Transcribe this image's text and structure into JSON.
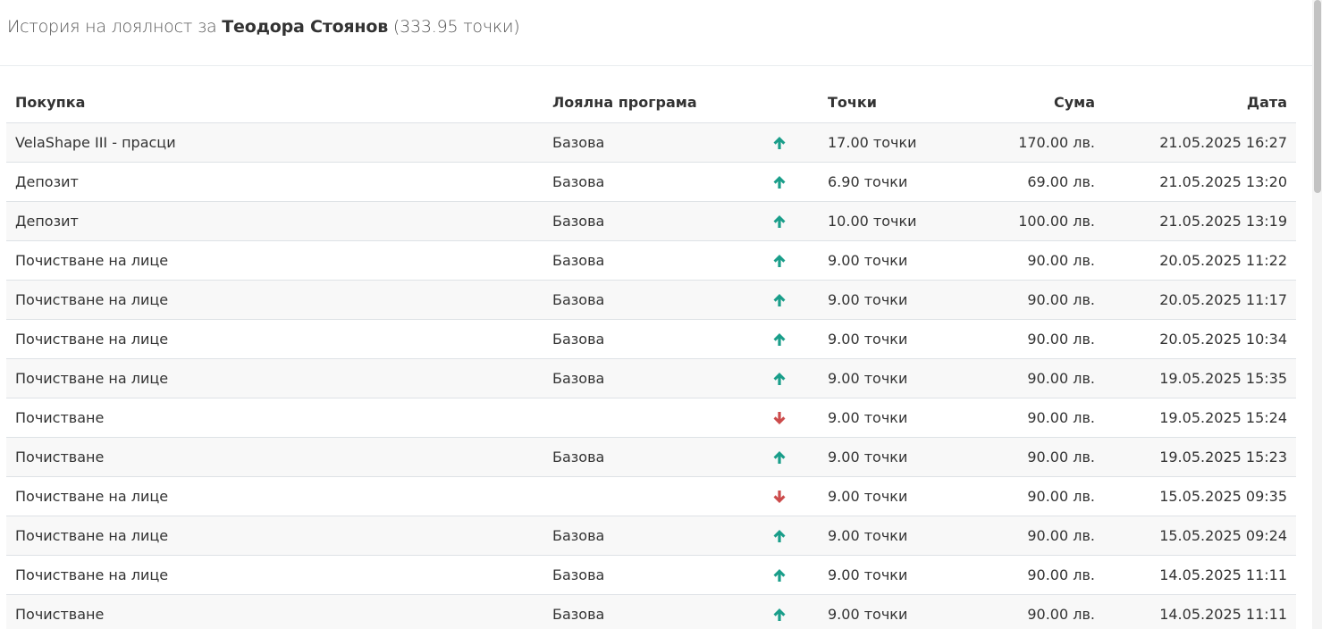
{
  "header": {
    "title_prefix": "История на лоялност за",
    "customer_name": "Теодора Стоянов",
    "points_total": "(333.95 точки)"
  },
  "table": {
    "columns": {
      "purchase": "Покупка",
      "program": "Лоялна програма",
      "direction": "",
      "points": "Точки",
      "amount": "Сума",
      "date": "Дата"
    },
    "rows": [
      {
        "purchase": "VelaShape III - прасци",
        "program": "Базова",
        "direction": "up",
        "points": "17.00 точки",
        "amount": "170.00 лв.",
        "date": "21.05.2025 16:27"
      },
      {
        "purchase": "Депозит",
        "program": "Базова",
        "direction": "up",
        "points": "6.90 точки",
        "amount": "69.00 лв.",
        "date": "21.05.2025 13:20"
      },
      {
        "purchase": "Депозит",
        "program": "Базова",
        "direction": "up",
        "points": "10.00 точки",
        "amount": "100.00 лв.",
        "date": "21.05.2025 13:19"
      },
      {
        "purchase": "Почистване на лице",
        "program": "Базова",
        "direction": "up",
        "points": "9.00 точки",
        "amount": "90.00 лв.",
        "date": "20.05.2025 11:22"
      },
      {
        "purchase": "Почистване на лице",
        "program": "Базова",
        "direction": "up",
        "points": "9.00 точки",
        "amount": "90.00 лв.",
        "date": "20.05.2025 11:17"
      },
      {
        "purchase": "Почистване на лице",
        "program": "Базова",
        "direction": "up",
        "points": "9.00 точки",
        "amount": "90.00 лв.",
        "date": "20.05.2025 10:34"
      },
      {
        "purchase": "Почистване на лице",
        "program": "Базова",
        "direction": "up",
        "points": "9.00 точки",
        "amount": "90.00 лв.",
        "date": "19.05.2025 15:35"
      },
      {
        "purchase": "Почистване",
        "program": "",
        "direction": "down",
        "points": "9.00 точки",
        "amount": "90.00 лв.",
        "date": "19.05.2025 15:24"
      },
      {
        "purchase": "Почистване",
        "program": "Базова",
        "direction": "up",
        "points": "9.00 точки",
        "amount": "90.00 лв.",
        "date": "19.05.2025 15:23"
      },
      {
        "purchase": "Почистване на лице",
        "program": "",
        "direction": "down",
        "points": "9.00 точки",
        "amount": "90.00 лв.",
        "date": "15.05.2025 09:35"
      },
      {
        "purchase": "Почистване на лице",
        "program": "Базова",
        "direction": "up",
        "points": "9.00 точки",
        "amount": "90.00 лв.",
        "date": "15.05.2025 09:24"
      },
      {
        "purchase": "Почистване на лице",
        "program": "Базова",
        "direction": "up",
        "points": "9.00 точки",
        "amount": "90.00 лв.",
        "date": "14.05.2025 11:11"
      },
      {
        "purchase": "Почистване",
        "program": "Базова",
        "direction": "up",
        "points": "9.00 точки",
        "amount": "90.00 лв.",
        "date": "14.05.2025 11:11"
      }
    ]
  },
  "icons": {
    "up": "arrow-up-icon",
    "down": "arrow-down-icon"
  },
  "colors": {
    "up": "#1a9e8a",
    "down": "#cc4b4b",
    "stripe": "#f8f8f8",
    "border": "#dee2e6"
  }
}
